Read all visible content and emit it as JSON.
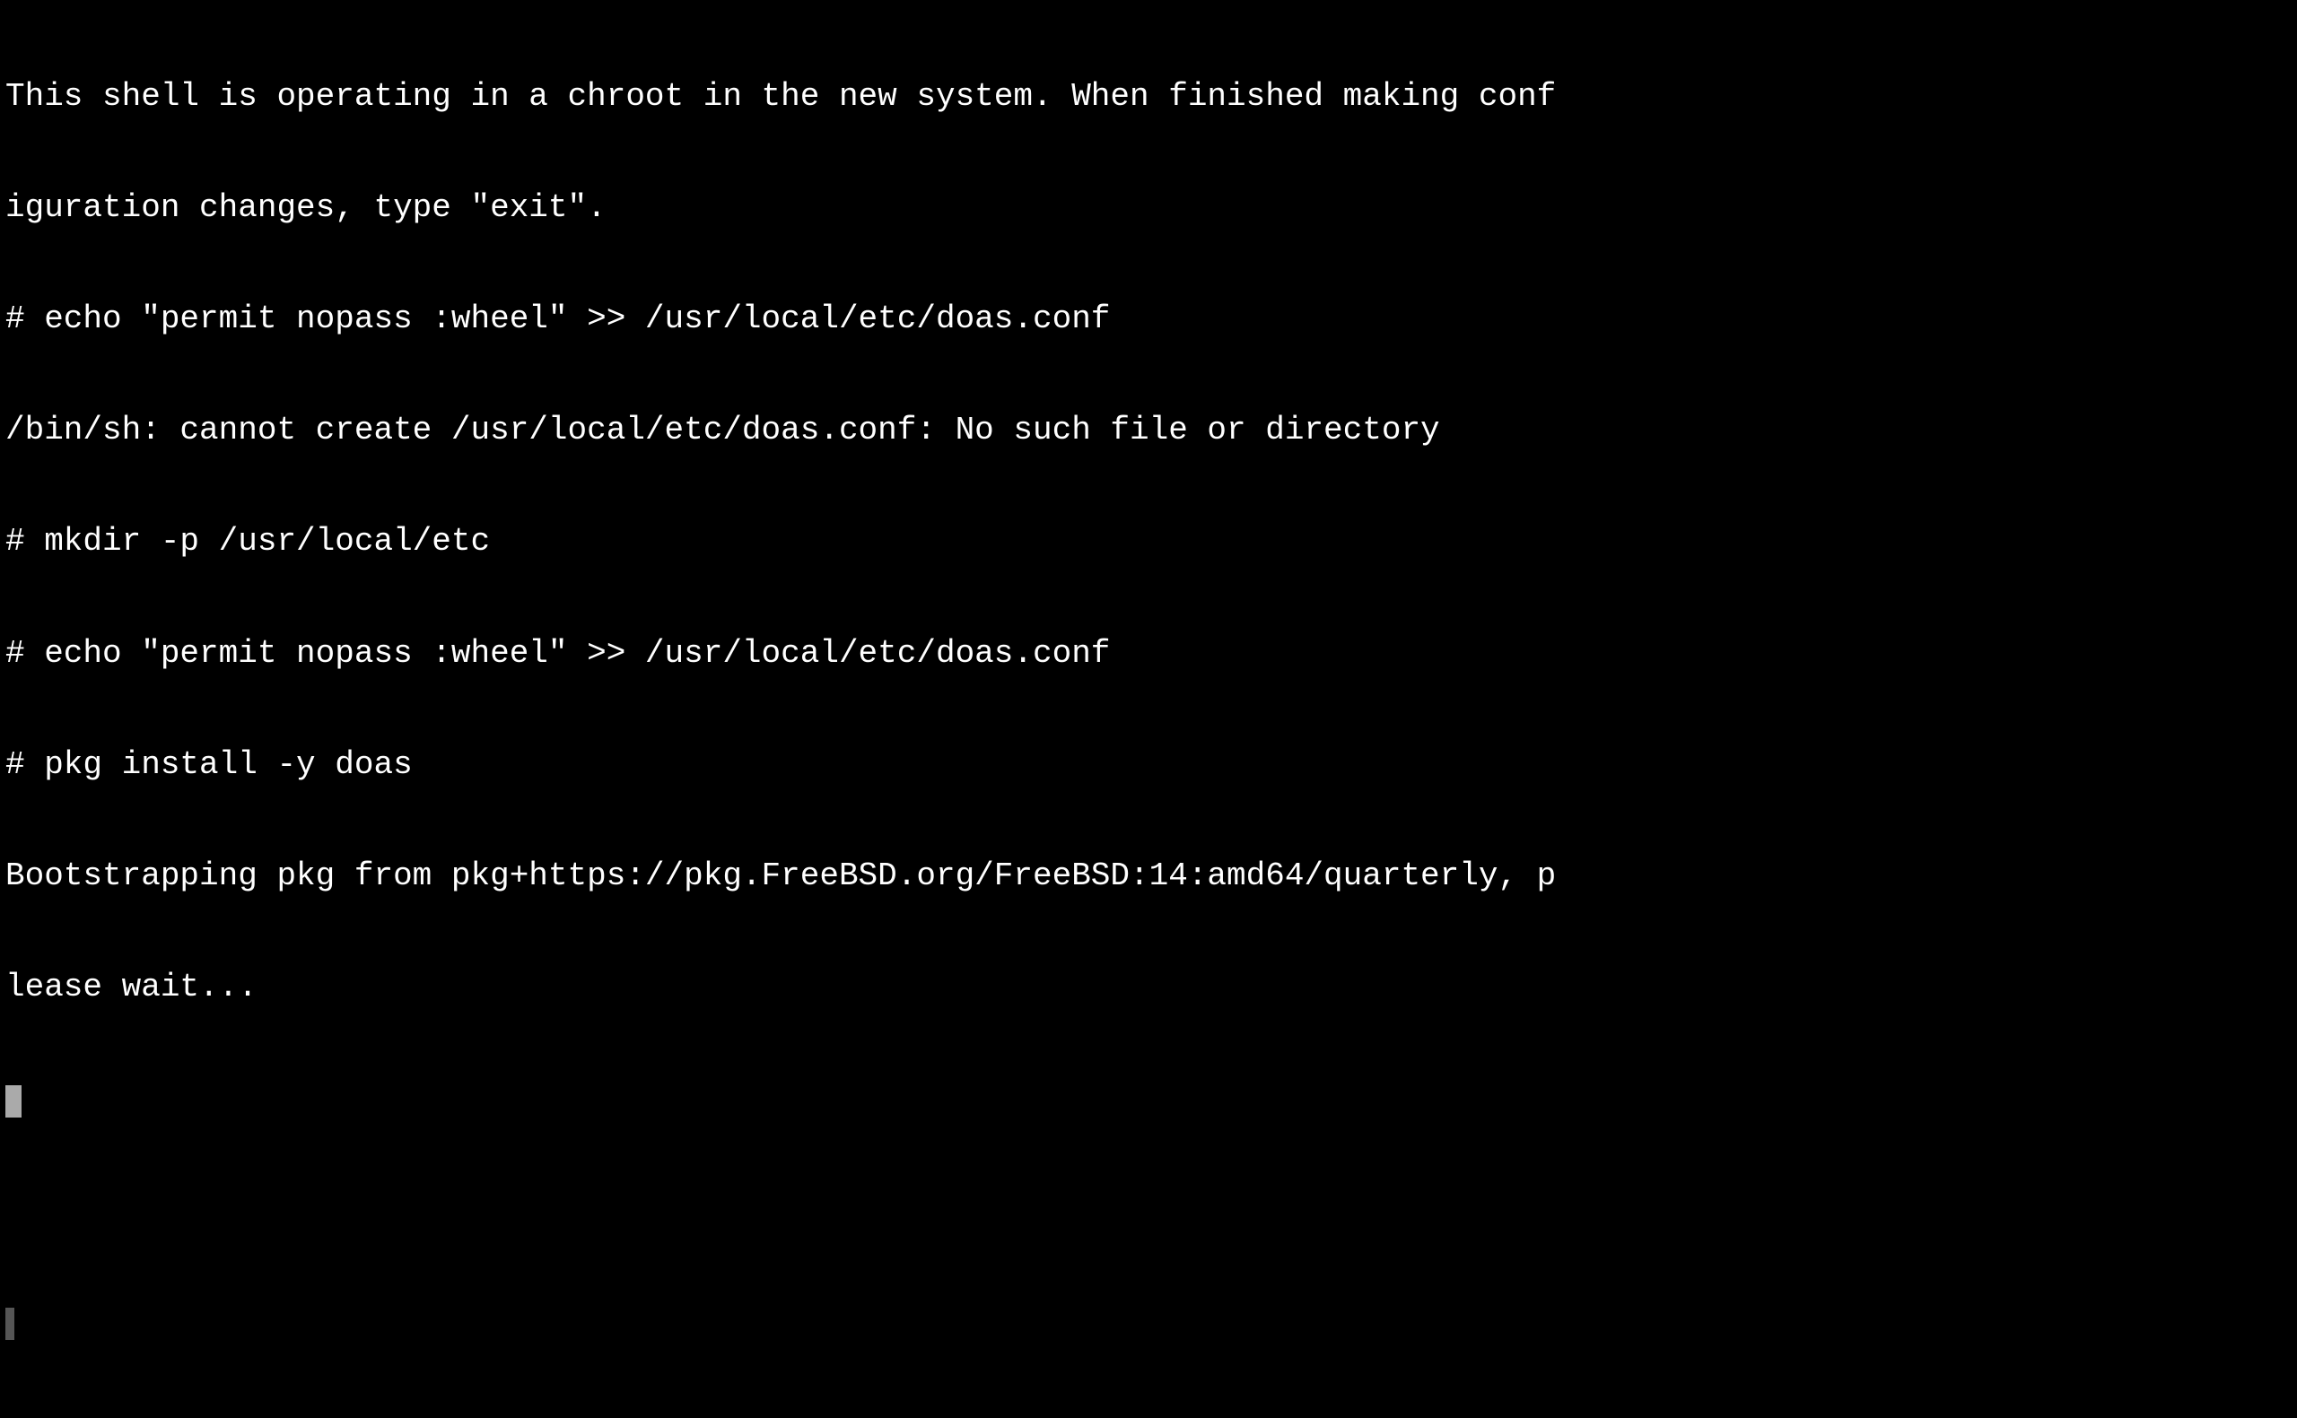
{
  "terminal": {
    "lines": [
      {
        "id": "line1",
        "text": "This shell is operating in a chroot in the new system. When finished making conf",
        "type": "output"
      },
      {
        "id": "line2",
        "text": "iguration changes, type \"exit\".",
        "type": "output"
      },
      {
        "id": "line3",
        "text": "# echo \"permit nopass :wheel\" >> /usr/local/etc/doas.conf",
        "type": "command"
      },
      {
        "id": "line4",
        "text": "/bin/sh: cannot create /usr/local/etc/doas.conf: No such file or directory",
        "type": "output"
      },
      {
        "id": "line5",
        "text": "# mkdir -p /usr/local/etc",
        "type": "command"
      },
      {
        "id": "line6",
        "text": "# echo \"permit nopass :wheel\" >> /usr/local/etc/doas.conf",
        "type": "command"
      },
      {
        "id": "line7",
        "text": "# pkg install -y doas",
        "type": "command"
      },
      {
        "id": "line8",
        "text": "Bootstrapping pkg from pkg+https://pkg.FreeBSD.org/FreeBSD:14:amd64/quarterly, p",
        "type": "output"
      },
      {
        "id": "line9",
        "text": "lease wait...",
        "type": "output"
      },
      {
        "id": "line10",
        "text": "",
        "type": "cursor-line",
        "has_block_cursor": true
      },
      {
        "id": "line11",
        "text": "",
        "type": "empty"
      },
      {
        "id": "line12",
        "text": "",
        "type": "small-cursor-line",
        "has_small_cursor": true
      }
    ]
  }
}
